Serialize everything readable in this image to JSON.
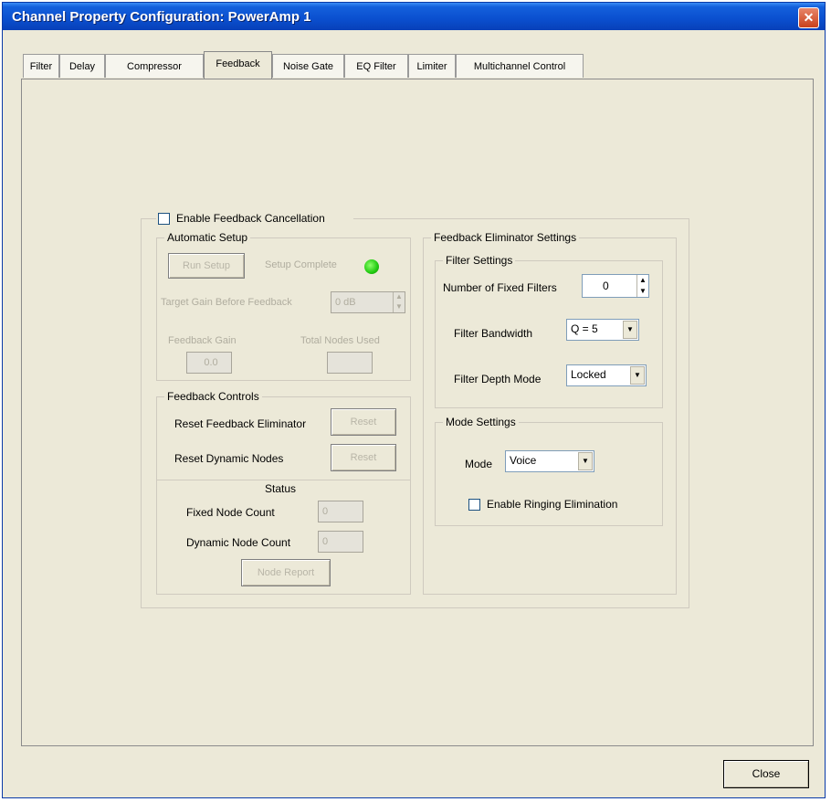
{
  "window": {
    "title": "Channel Property Configuration: PowerAmp 1",
    "close_glyph": "✕"
  },
  "tabs": [
    {
      "label": "Filter"
    },
    {
      "label": "Delay"
    },
    {
      "label": "Compressor"
    },
    {
      "label": "Feedback"
    },
    {
      "label": "Noise Gate"
    },
    {
      "label": "EQ Filter"
    },
    {
      "label": "Limiter"
    },
    {
      "label": "Multichannel Control"
    }
  ],
  "active_tab": "Feedback",
  "feedback": {
    "enable_label": "Enable Feedback Cancellation",
    "automatic_setup": {
      "title": "Automatic Setup",
      "run_setup_label": "Run Setup",
      "setup_complete_label": "Setup Complete",
      "target_gain_label": "Target Gain Before Feedback",
      "target_gain_value": "0 dB",
      "feedback_gain_label": "Feedback Gain",
      "feedback_gain_value": "0.0",
      "total_nodes_label": "Total Nodes Used",
      "total_nodes_value": ""
    },
    "controls": {
      "title": "Feedback Controls",
      "reset_eliminator_label": "Reset Feedback Eliminator",
      "reset_dynamic_label": "Reset Dynamic Nodes",
      "reset_button_label": "Reset",
      "status_title": "Status",
      "fixed_count_label": "Fixed Node Count",
      "fixed_count_value": "0",
      "dynamic_count_label": "Dynamic Node Count",
      "dynamic_count_value": "0",
      "node_report_label": "Node Report"
    },
    "eliminator": {
      "title": "Feedback Eliminator Settings",
      "filter_settings_title": "Filter Settings",
      "fixed_filters_label": "Number of Fixed Filters",
      "fixed_filters_value": "0",
      "bandwidth_label": "Filter Bandwidth",
      "bandwidth_value": "Q = 5",
      "depth_label": "Filter Depth Mode",
      "depth_value": "Locked",
      "mode_settings_title": "Mode Settings",
      "mode_label": "Mode",
      "mode_value": "Voice",
      "ringing_label": "Enable Ringing Elimination"
    }
  },
  "footer": {
    "close_label": "Close"
  },
  "colors": {
    "titlebar": "#0a4fcf",
    "led": "#20c910",
    "dialog_bg": "#ece9d8"
  }
}
